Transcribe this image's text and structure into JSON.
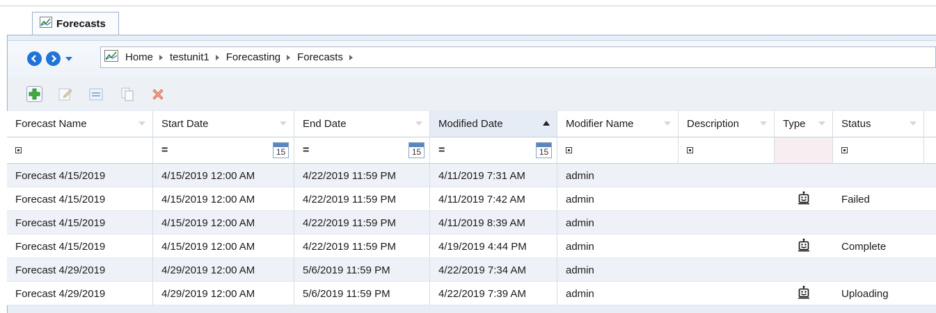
{
  "tab": {
    "label": "Forecasts",
    "icon": "forecast-chart-icon"
  },
  "nav": {
    "back_icon": "back-arrow-icon",
    "forward_icon": "forward-arrow-icon",
    "history_icon": "history-dropdown-icon",
    "location_icon": "forecast-chart-icon",
    "breadcrumbs": [
      "Home",
      "testunit1",
      "Forecasting",
      "Forecasts"
    ]
  },
  "toolbar": {
    "buttons": [
      {
        "name": "add-button",
        "icon": "plus-icon",
        "enabled": true
      },
      {
        "name": "edit-button",
        "icon": "edit-icon",
        "enabled": false
      },
      {
        "name": "properties-button",
        "icon": "properties-icon",
        "enabled": false
      },
      {
        "name": "copy-button",
        "icon": "copy-icon",
        "enabled": false
      },
      {
        "name": "delete-button",
        "icon": "delete-x-icon",
        "enabled": false
      }
    ]
  },
  "grid": {
    "columns": [
      "Forecast Name",
      "Start Date",
      "End Date",
      "Modified Date",
      "Modifier Name",
      "Description",
      "Type",
      "Status"
    ],
    "sorted_column": "Modified Date",
    "sort_direction": "ascending",
    "filters": {
      "operator_symbol": "=",
      "calendar_day": "15"
    },
    "rows": [
      {
        "name": "Forecast 4/15/2019",
        "start": "4/15/2019 12:00 AM",
        "end": "4/22/2019 11:59 PM",
        "modified": "4/11/2019 7:31 AM",
        "modifier": "admin",
        "description": "",
        "type_icon": "",
        "status": ""
      },
      {
        "name": "Forecast 4/15/2019",
        "start": "4/15/2019 12:00 AM",
        "end": "4/22/2019 11:59 PM",
        "modified": "4/11/2019 7:42 AM",
        "modifier": "admin",
        "description": "",
        "type_icon": "robot-icon",
        "status": "Failed"
      },
      {
        "name": "Forecast 4/15/2019",
        "start": "4/15/2019 12:00 AM",
        "end": "4/22/2019 11:59 PM",
        "modified": "4/11/2019 8:39 AM",
        "modifier": "admin",
        "description": "",
        "type_icon": "",
        "status": ""
      },
      {
        "name": "Forecast 4/15/2019",
        "start": "4/15/2019 12:00 AM",
        "end": "4/22/2019 11:59 PM",
        "modified": "4/19/2019 4:44 PM",
        "modifier": "admin",
        "description": "",
        "type_icon": "robot-icon",
        "status": "Complete"
      },
      {
        "name": "Forecast 4/29/2019",
        "start": "4/29/2019 12:00 AM",
        "end": "5/6/2019 11:59 PM",
        "modified": "4/22/2019 7:34 AM",
        "modifier": "admin",
        "description": "",
        "type_icon": "",
        "status": ""
      },
      {
        "name": "Forecast 4/29/2019",
        "start": "4/29/2019 12:00 AM",
        "end": "5/6/2019 11:59 PM",
        "modified": "4/22/2019 7:39 AM",
        "modifier": "admin",
        "description": "",
        "type_icon": "robot-icon",
        "status": "Uploading"
      }
    ]
  },
  "colors": {
    "accent": "#1f73d9",
    "header_border": "#9ab0cc",
    "alt_row": "#eef2f8"
  }
}
